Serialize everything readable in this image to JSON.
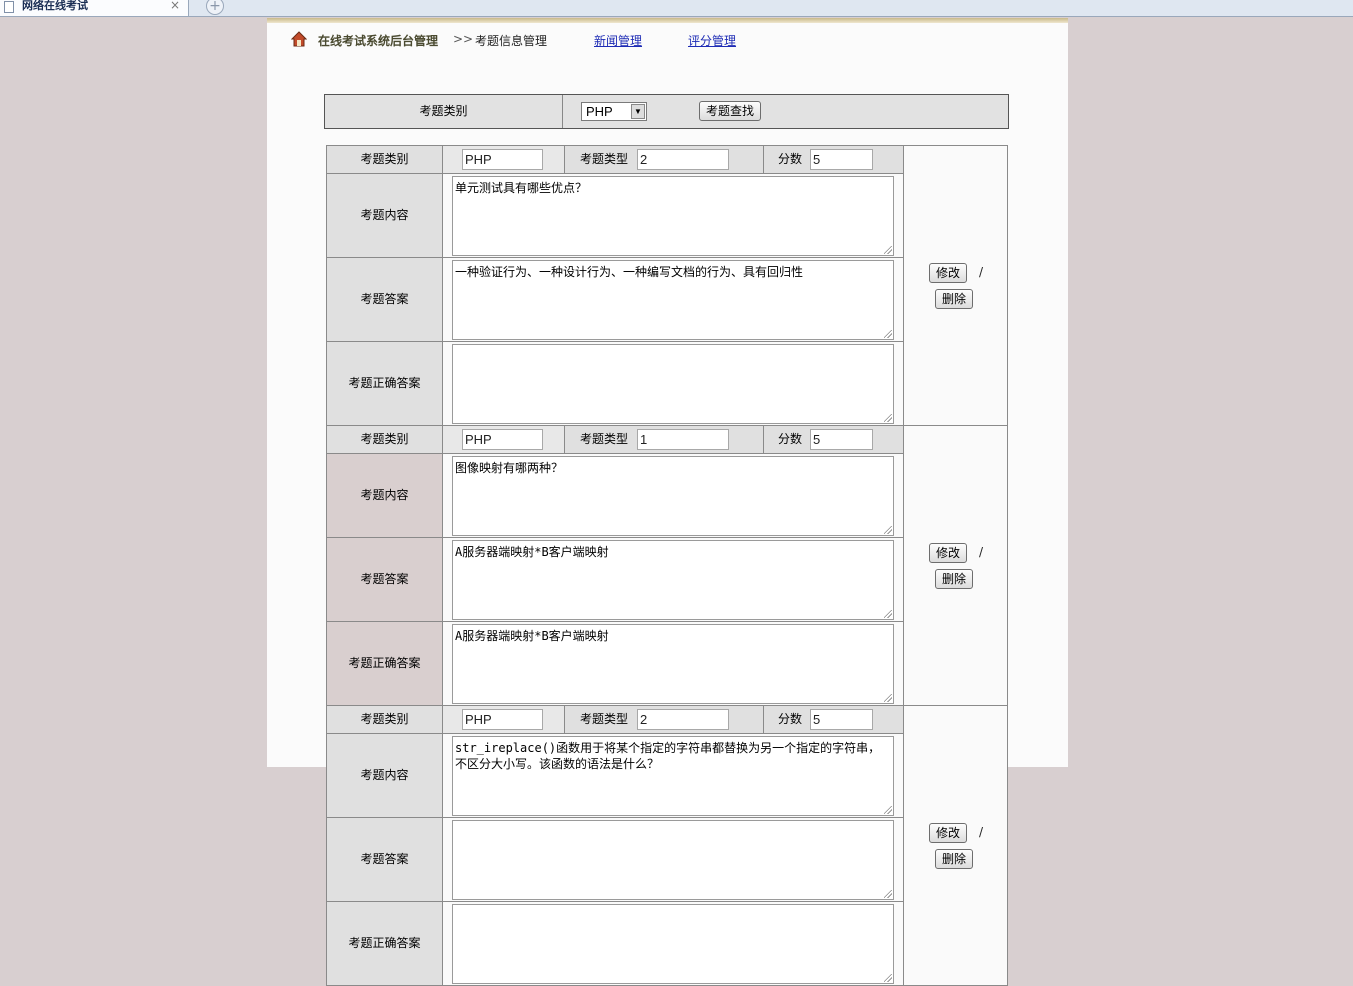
{
  "browser": {
    "tab_title": "网络在线考试",
    "tab_close": "×",
    "new_tab": "+"
  },
  "nav": {
    "breadcrumb_root": "在线考试系统后台管理",
    "breadcrumb_sep": ">>",
    "breadcrumb_current": "考题信息管理",
    "link_news": "新闻管理",
    "link_score": "评分管理"
  },
  "search": {
    "label": "考题类别",
    "selected": "PHP",
    "button": "考题查找"
  },
  "labels": {
    "category": "考题类别",
    "type": "考题类型",
    "score": "分数",
    "content": "考题内容",
    "answer": "考题答案",
    "correct": "考题正确答案",
    "edit": "修改",
    "slash": "/",
    "delete": "删除"
  },
  "questions": [
    {
      "category": "PHP",
      "type": "2",
      "score": "5",
      "content": "单元测试具有哪些优点？",
      "answer": "一种验证行为、一种设计行为、一种编写文档的行为、具有回归性",
      "correct": ""
    },
    {
      "category": "PHP",
      "type": "1",
      "score": "5",
      "content": "图像映射有哪两种？",
      "answer": "A服务器端映射*B客户端映射",
      "correct": "A服务器端映射*B客户端映射"
    },
    {
      "category": "PHP",
      "type": "2",
      "score": "5",
      "content": "str_ireplace()函数用于将某个指定的字符串都替换为另一个指定的字符串，不区分大小写。该函数的语法是什么？",
      "answer": "",
      "correct": ""
    }
  ]
}
